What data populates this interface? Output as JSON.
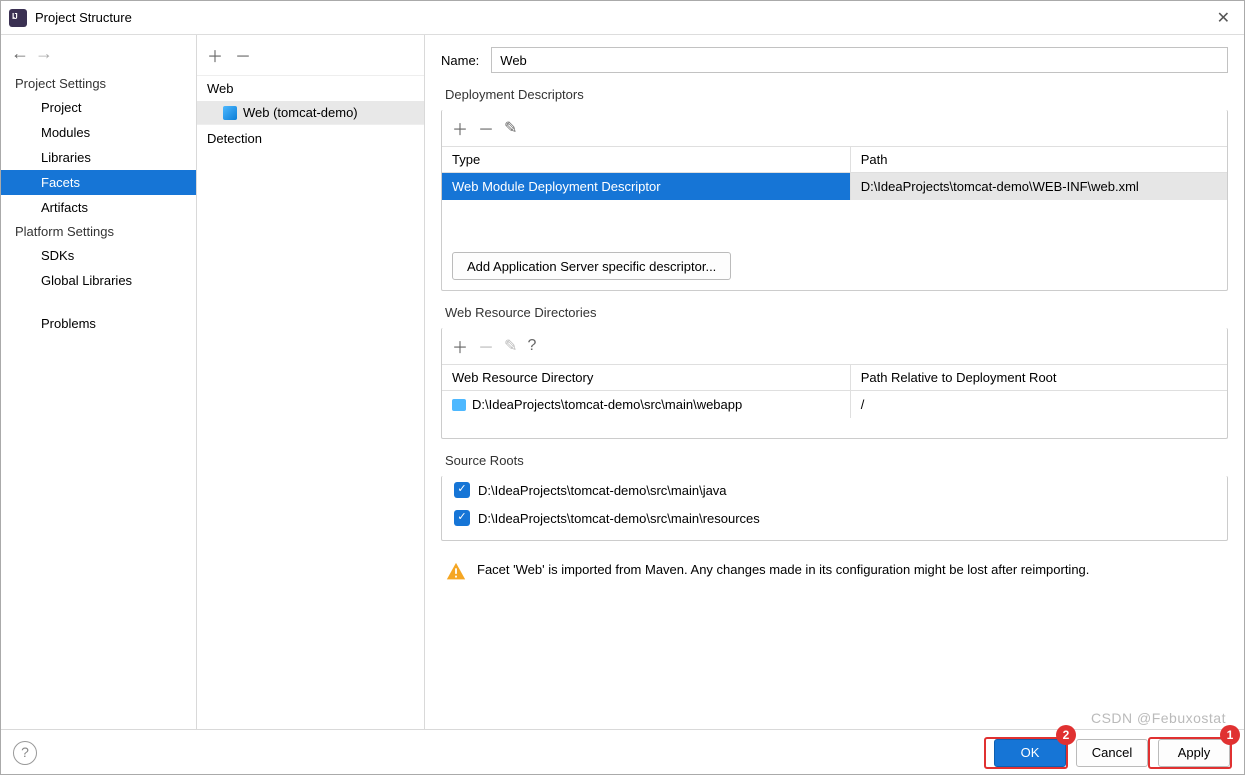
{
  "window": {
    "title": "Project Structure"
  },
  "sidebar": {
    "section1": "Project Settings",
    "items1": [
      "Project",
      "Modules",
      "Libraries",
      "Facets",
      "Artifacts"
    ],
    "section2": "Platform Settings",
    "items2": [
      "SDKs",
      "Global Libraries"
    ],
    "problems": "Problems"
  },
  "middle": {
    "group": "Web",
    "item": "Web (tomcat-demo)",
    "detection": "Detection"
  },
  "main": {
    "name_label": "Name:",
    "name_value": "Web",
    "dep_legend": "Deployment Descriptors",
    "dep_th_type": "Type",
    "dep_th_path": "Path",
    "dep_row_type": "Web Module Deployment Descriptor",
    "dep_row_path": "D:\\IdeaProjects\\tomcat-demo\\WEB-INF\\web.xml",
    "add_desc_btn": "Add Application Server specific descriptor...",
    "wr_legend": "Web Resource Directories",
    "wr_th_dir": "Web Resource Directory",
    "wr_th_rel": "Path Relative to Deployment Root",
    "wr_row_dir": "D:\\IdeaProjects\\tomcat-demo\\src\\main\\webapp",
    "wr_row_rel": "/",
    "sr_legend": "Source Roots",
    "sr_1": "D:\\IdeaProjects\\tomcat-demo\\src\\main\\java",
    "sr_2": "D:\\IdeaProjects\\tomcat-demo\\src\\main\\resources",
    "warn_text": "Facet 'Web' is imported from Maven. Any changes made in its configuration might be lost after reimporting."
  },
  "footer": {
    "ok": "OK",
    "cancel": "Cancel",
    "apply": "Apply"
  },
  "callouts": {
    "ok": "2",
    "apply": "1"
  },
  "watermark": "CSDN @Febuxostat"
}
